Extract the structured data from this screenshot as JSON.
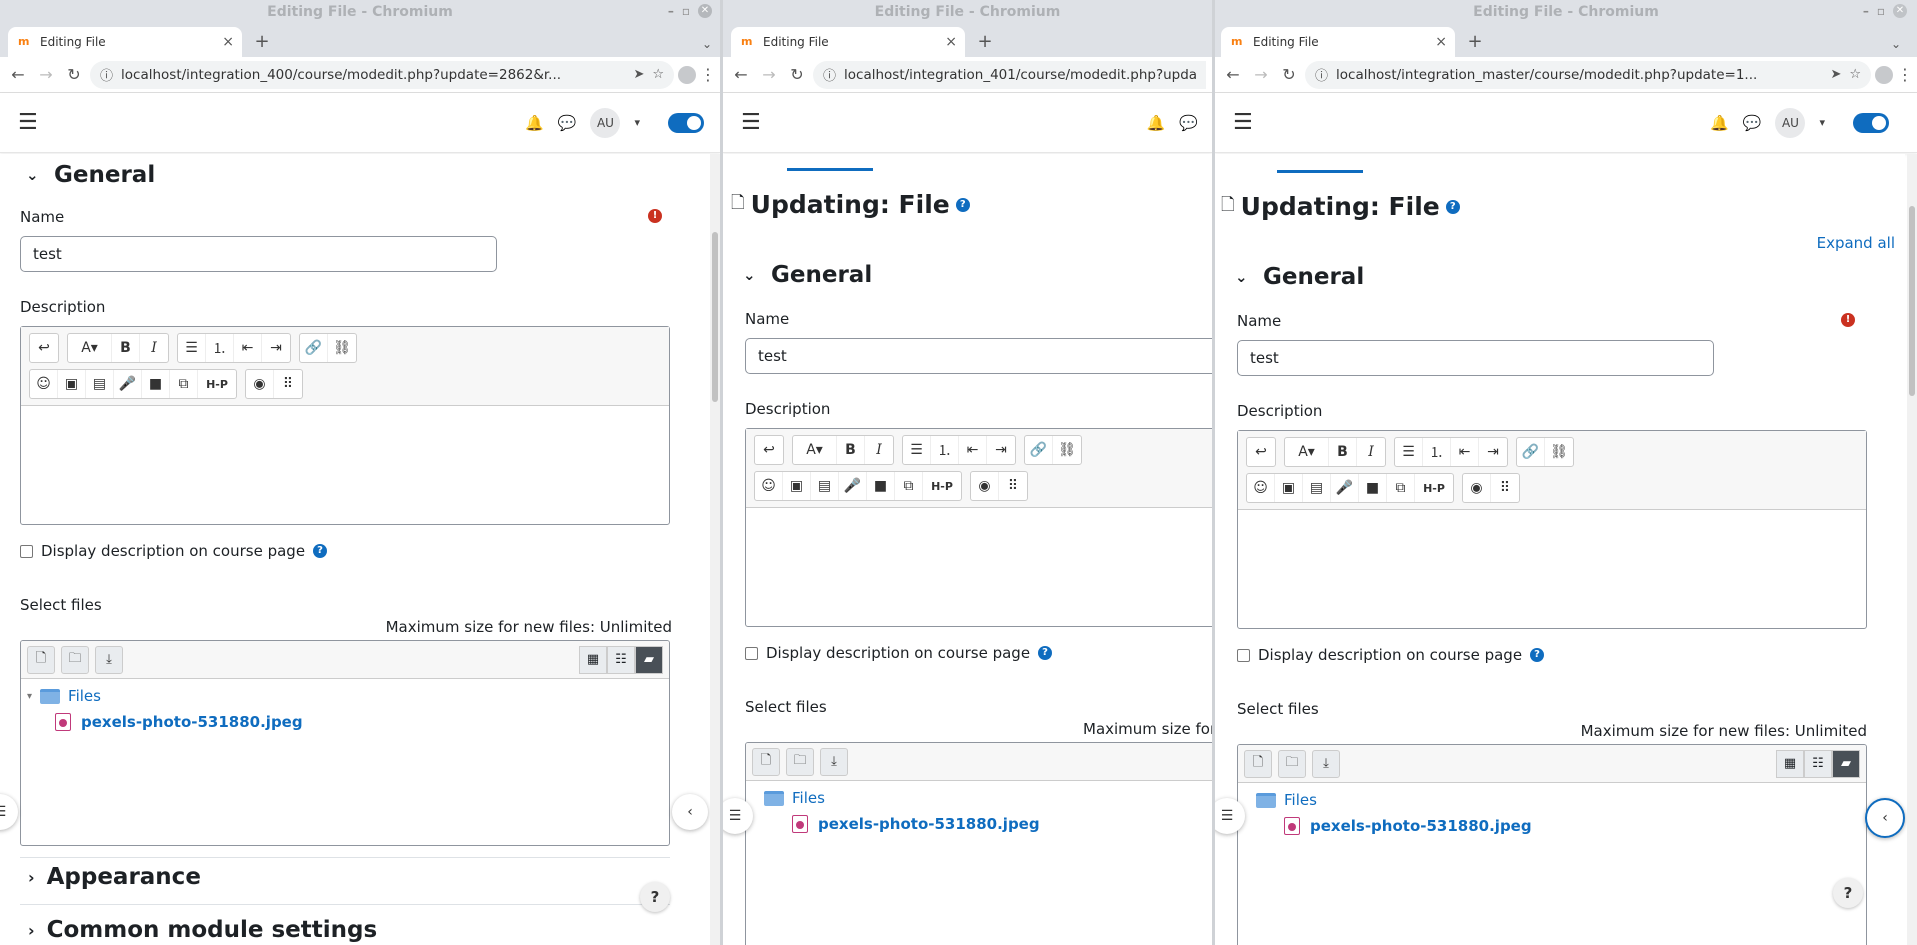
{
  "window_title": "Editing File - Chromium",
  "tab_title": "Editing File",
  "toolbar_glyphs": {
    "undo": "↩",
    "font": "A▾",
    "bold": "B",
    "italic": "I",
    "bullets": "☰",
    "numbers": "⒈",
    "outdent": "⇤",
    "indent": "⇥",
    "link": "🔗",
    "unlink": "⛓",
    "emoji": "☺",
    "image": "▣",
    "media": "▤",
    "record_audio": "🎤",
    "record_video": "■",
    "copy": "⧉",
    "h5p": "H-P",
    "access": "◉",
    "screenreader": "⠿"
  },
  "windows": [
    {
      "url": "localhost/integration_400/course/modedit.php?update=2862&r...",
      "user_initials": "AU",
      "section_general": "General",
      "name_label": "Name",
      "name_value": "test",
      "description_label": "Description",
      "display_desc_label": "Display description on course page",
      "select_files_label": "Select files",
      "max_size": "Maximum size for new files: Unlimited",
      "folder_name": "Files",
      "file_name": "pexels-photo-531880.jpeg",
      "section_appearance": "Appearance",
      "section_common": "Common module settings"
    },
    {
      "url": "localhost/integration_401/course/modedit.php?upda",
      "page_heading": "Updating: File",
      "section_general": "General",
      "name_label": "Name",
      "name_value": "test",
      "description_label": "Description",
      "display_desc_label": "Display description on course page",
      "select_files_label": "Select files",
      "max_size": "Maximum size for n",
      "folder_name": "Files",
      "file_name": "pexels-photo-531880.jpeg"
    },
    {
      "url": "localhost/integration_master/course/modedit.php?update=1...",
      "user_initials": "AU",
      "page_heading": "Updating: File",
      "expand_all": "Expand all",
      "section_general": "General",
      "name_label": "Name",
      "name_value": "test",
      "description_label": "Description",
      "display_desc_label": "Display description on course page",
      "select_files_label": "Select files",
      "max_size": "Maximum size for new files: Unlimited",
      "folder_name": "Files",
      "file_name": "pexels-photo-531880.jpeg"
    }
  ]
}
